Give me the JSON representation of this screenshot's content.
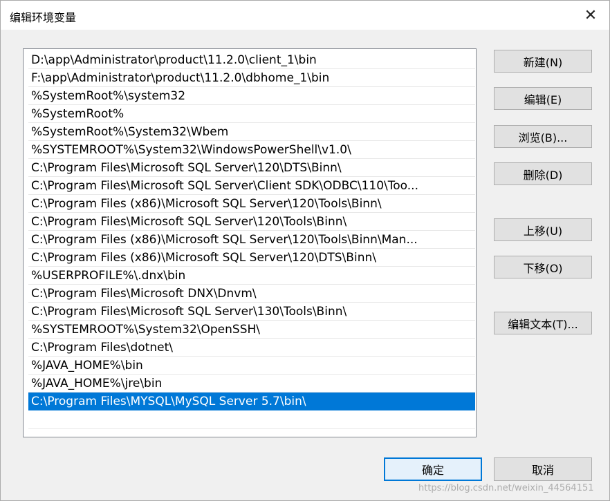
{
  "window": {
    "title": "编辑环境变量",
    "close_glyph": "✕"
  },
  "path_list": {
    "items": [
      "D:\\app\\Administrator\\product\\11.2.0\\client_1\\bin",
      "F:\\app\\Administrator\\product\\11.2.0\\dbhome_1\\bin",
      "%SystemRoot%\\system32",
      "%SystemRoot%",
      "%SystemRoot%\\System32\\Wbem",
      "%SYSTEMROOT%\\System32\\WindowsPowerShell\\v1.0\\",
      "C:\\Program Files\\Microsoft SQL Server\\120\\DTS\\Binn\\",
      "C:\\Program Files\\Microsoft SQL Server\\Client SDK\\ODBC\\110\\Too...",
      "C:\\Program Files (x86)\\Microsoft SQL Server\\120\\Tools\\Binn\\",
      "C:\\Program Files\\Microsoft SQL Server\\120\\Tools\\Binn\\",
      "C:\\Program Files (x86)\\Microsoft SQL Server\\120\\Tools\\Binn\\Man...",
      "C:\\Program Files (x86)\\Microsoft SQL Server\\120\\DTS\\Binn\\",
      "%USERPROFILE%\\.dnx\\bin",
      "C:\\Program Files\\Microsoft DNX\\Dnvm\\",
      "C:\\Program Files\\Microsoft SQL Server\\130\\Tools\\Binn\\",
      "%SYSTEMROOT%\\System32\\OpenSSH\\",
      "C:\\Program Files\\dotnet\\",
      "%JAVA_HOME%\\bin",
      "%JAVA_HOME%\\jre\\bin",
      "C:\\Program Files\\MYSQL\\MySQL Server 5.7\\bin\\"
    ],
    "selected_index": 19
  },
  "buttons": {
    "new": "新建(N)",
    "edit": "编辑(E)",
    "browse": "浏览(B)...",
    "delete": "删除(D)",
    "move_up": "上移(U)",
    "move_down": "下移(O)",
    "edit_text": "编辑文本(T)...",
    "ok": "确定",
    "cancel": "取消"
  },
  "watermark": "https://blog.csdn.net/weixin_44564151",
  "colors": {
    "selection": "#0078d7",
    "dialog_bg": "#f0f0f0",
    "default_button_border": "#0078d7"
  }
}
